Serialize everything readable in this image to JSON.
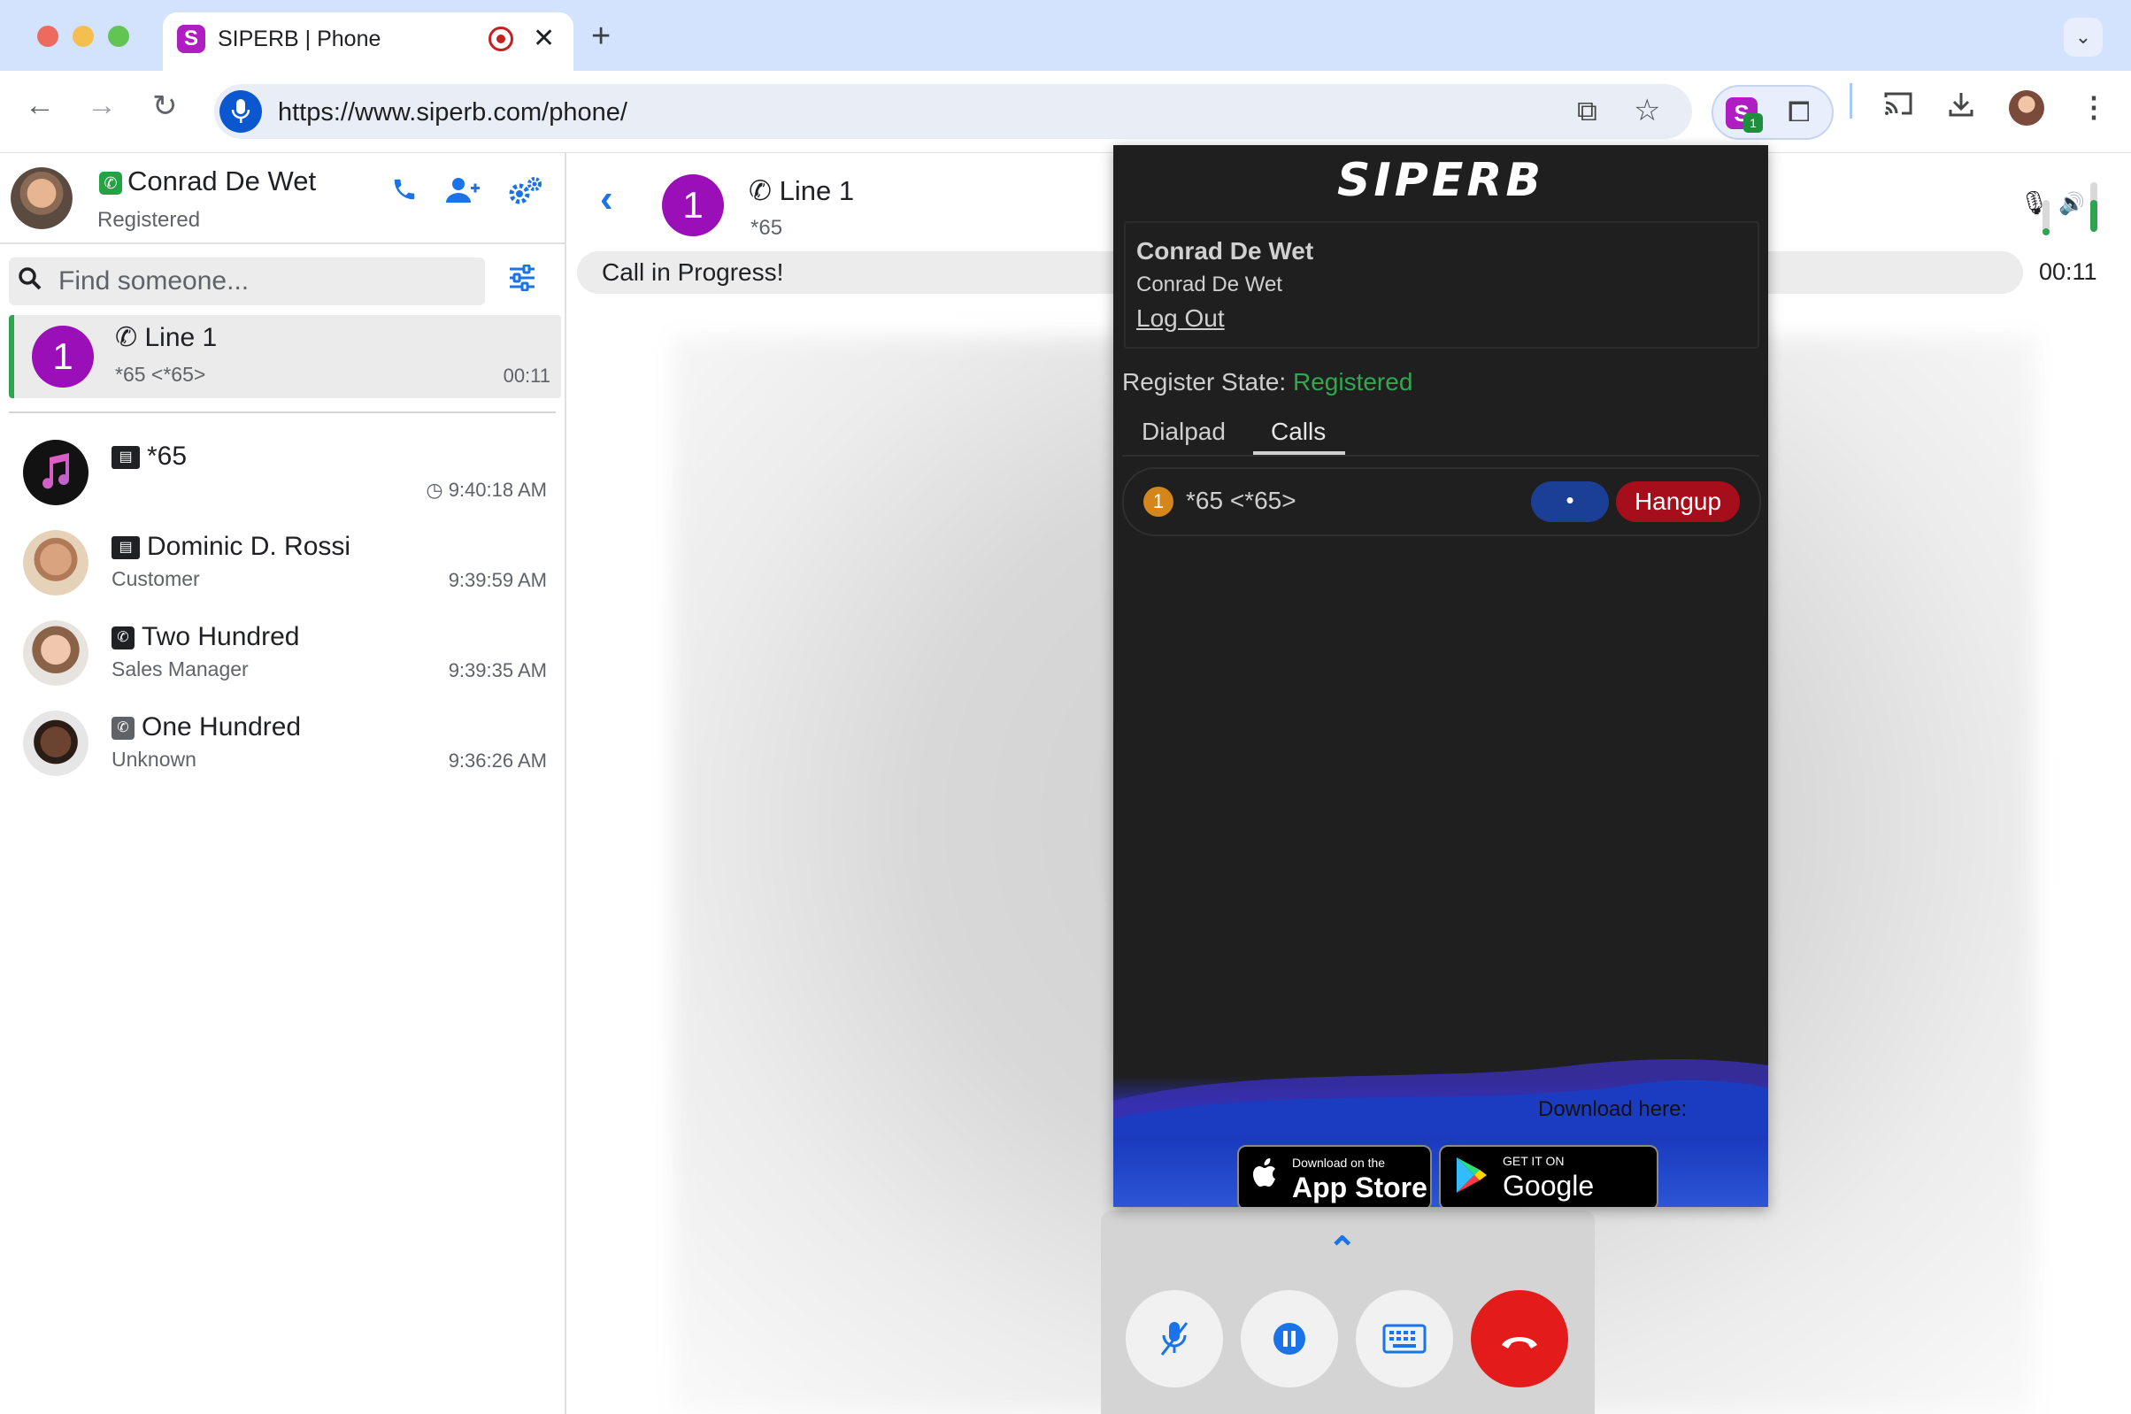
{
  "browser": {
    "tab_title": "SIPERB | Phone",
    "tab_favicon_letter": "S",
    "close_glyph": "✕",
    "new_tab_glyph": "+",
    "tab_menu_glyph": "⌄",
    "url": "https://www.siperb.com/phone/",
    "extension_badge": "1",
    "colors": {
      "tabbar": "#d3e3fd",
      "brand": "#b01ec3"
    }
  },
  "sidebar": {
    "user": {
      "name": "Conrad De Wet",
      "status": "Registered"
    },
    "search_placeholder": "Find someone...",
    "active_line": {
      "avatar_number": "1",
      "title": "Line 1",
      "subtitle": "*65 <*65>",
      "duration": "00:11"
    },
    "contacts": [
      {
        "name": "*65",
        "subtitle": "",
        "time": "9:40:18 AM",
        "icon": "contact-card-icon",
        "avatar": "music-app-icon"
      },
      {
        "name": "Dominic D. Rossi",
        "subtitle": "Customer",
        "time": "9:39:59 AM",
        "icon": "contact-card-icon",
        "avatar": "avatar"
      },
      {
        "name": "Two Hundred",
        "subtitle": "Sales Manager",
        "time": "9:39:35 AM",
        "icon": "phone-icon",
        "avatar": "avatar"
      },
      {
        "name": "One Hundred",
        "subtitle": "Unknown",
        "time": "9:36:26 AM",
        "icon": "phone-icon",
        "avatar": "avatar"
      }
    ]
  },
  "call": {
    "avatar_number": "1",
    "line_title": "Line 1",
    "line_sub": "*65",
    "status": "Call in Progress!",
    "timer": "00:11",
    "mic_level": 0.2,
    "speaker_level": 0.65
  },
  "popup": {
    "logo": "SIPERB",
    "account_name": "Conrad De Wet",
    "account_sub": "Conrad De Wet",
    "logout": "Log Out",
    "register_label": "Register State:",
    "register_value": "Registered",
    "tabs": [
      "Dialpad",
      "Calls"
    ],
    "active_tab": "Calls",
    "call": {
      "number": "1",
      "label": "*65 <*65>",
      "dot": "•",
      "hangup": "Hangup"
    },
    "download_here": "Download here:",
    "app_store": {
      "small": "Download on the",
      "big": "App Store"
    },
    "google_play": {
      "small": "GET IT ON",
      "big": "Google Play"
    }
  }
}
